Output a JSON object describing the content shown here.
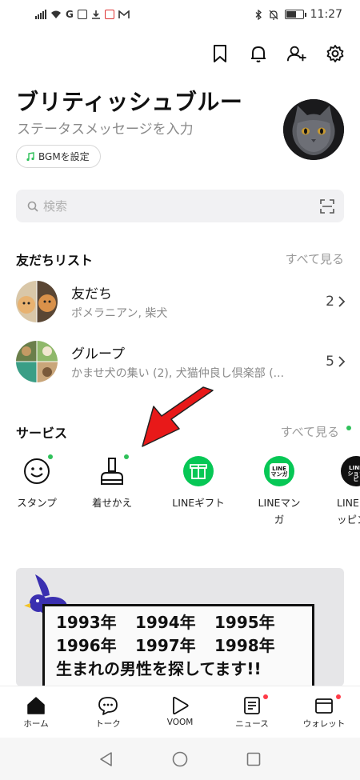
{
  "status_bar": {
    "network": "G",
    "time": "11:27"
  },
  "profile": {
    "name": "ブリティッシュブルー",
    "status_message": "ステータスメッセージを入力",
    "bgm_label": "BGMを設定"
  },
  "search": {
    "placeholder": "検索"
  },
  "friends_section": {
    "title": "友だちリスト",
    "see_all": "すべて見る",
    "rows": [
      {
        "title": "友だち",
        "subtitle": "ポメラニアン, 柴犬",
        "count": "2"
      },
      {
        "title": "グループ",
        "subtitle": "かませ犬の集い (2), 犬猫仲良し倶楽部 (...",
        "count": "5"
      }
    ]
  },
  "services_section": {
    "title": "サービス",
    "see_all": "すべて見る",
    "items": [
      {
        "label": "スタンプ",
        "icon": "smiley-icon"
      },
      {
        "label": "着せかえ",
        "icon": "paintbrush-icon"
      },
      {
        "label": "LINEギフト",
        "icon": "gift-icon"
      },
      {
        "label": "LINEマンガ",
        "icon": "line-manga-icon",
        "badge": "LINE マンガ"
      },
      {
        "label": "LINEショッピング",
        "icon": "line-shopping-icon",
        "badge": "LINE ショッピ"
      }
    ]
  },
  "banner": {
    "years_row1": [
      "1993年",
      "1994年",
      "1995年"
    ],
    "years_row2": [
      "1996年",
      "1997年",
      "1998年"
    ],
    "headline": "生まれの男性を探してます!!"
  },
  "bottom_nav": [
    {
      "label": "ホーム",
      "icon": "home-icon",
      "active": true
    },
    {
      "label": "トーク",
      "icon": "chat-icon"
    },
    {
      "label": "VOOM",
      "icon": "voom-play-icon"
    },
    {
      "label": "ニュース",
      "icon": "news-icon",
      "badge": true
    },
    {
      "label": "ウォレット",
      "icon": "wallet-icon",
      "badge": true
    }
  ],
  "colors": {
    "line_green": "#06c755",
    "dot_green": "#2fc15a",
    "badge_red": "#ff3b48",
    "arrow_red": "#e81919"
  }
}
